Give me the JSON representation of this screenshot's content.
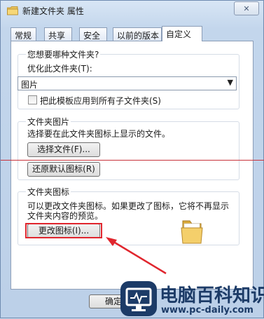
{
  "window": {
    "title": "新建文件夹 属性",
    "close_glyph": "✕"
  },
  "tabs": [
    {
      "label": "常规"
    },
    {
      "label": "共享"
    },
    {
      "label": "安全"
    },
    {
      "label": "以前的版本"
    },
    {
      "label": "自定义",
      "active": true
    }
  ],
  "optimize_group": {
    "heading": "您想要哪种文件夹?",
    "optimize_label": "优化此文件夹(T):",
    "optimize_value": "图片",
    "apply_checkbox_label": "把此模板应用到所有子文件夹(S)",
    "apply_checked": false
  },
  "folder_pictures": {
    "heading": "文件夹图片",
    "description": "选择要在此文件夹图标上显示的文件。",
    "choose_file_button": "选择文件(F)...",
    "restore_default_button": "还原默认图标(R)"
  },
  "folder_icons": {
    "heading": "文件夹图标",
    "description_line1": "可以更改文件夹图标。如果更改了图标，它将不再显示",
    "description_line2": "文件夹内容的预览。",
    "change_icon_button": "更改图标(I)..."
  },
  "footer": {
    "ok_button": "确定"
  },
  "watermark": {
    "name": "电脑百科知识",
    "url": "www.pc-daily.com"
  },
  "colors": {
    "annotation_red": "#e0262e",
    "brand_navy": "#1c3b67"
  },
  "icons": [
    "folder-icon",
    "close-icon",
    "chevron-down-icon",
    "monitor-logo-icon"
  ]
}
